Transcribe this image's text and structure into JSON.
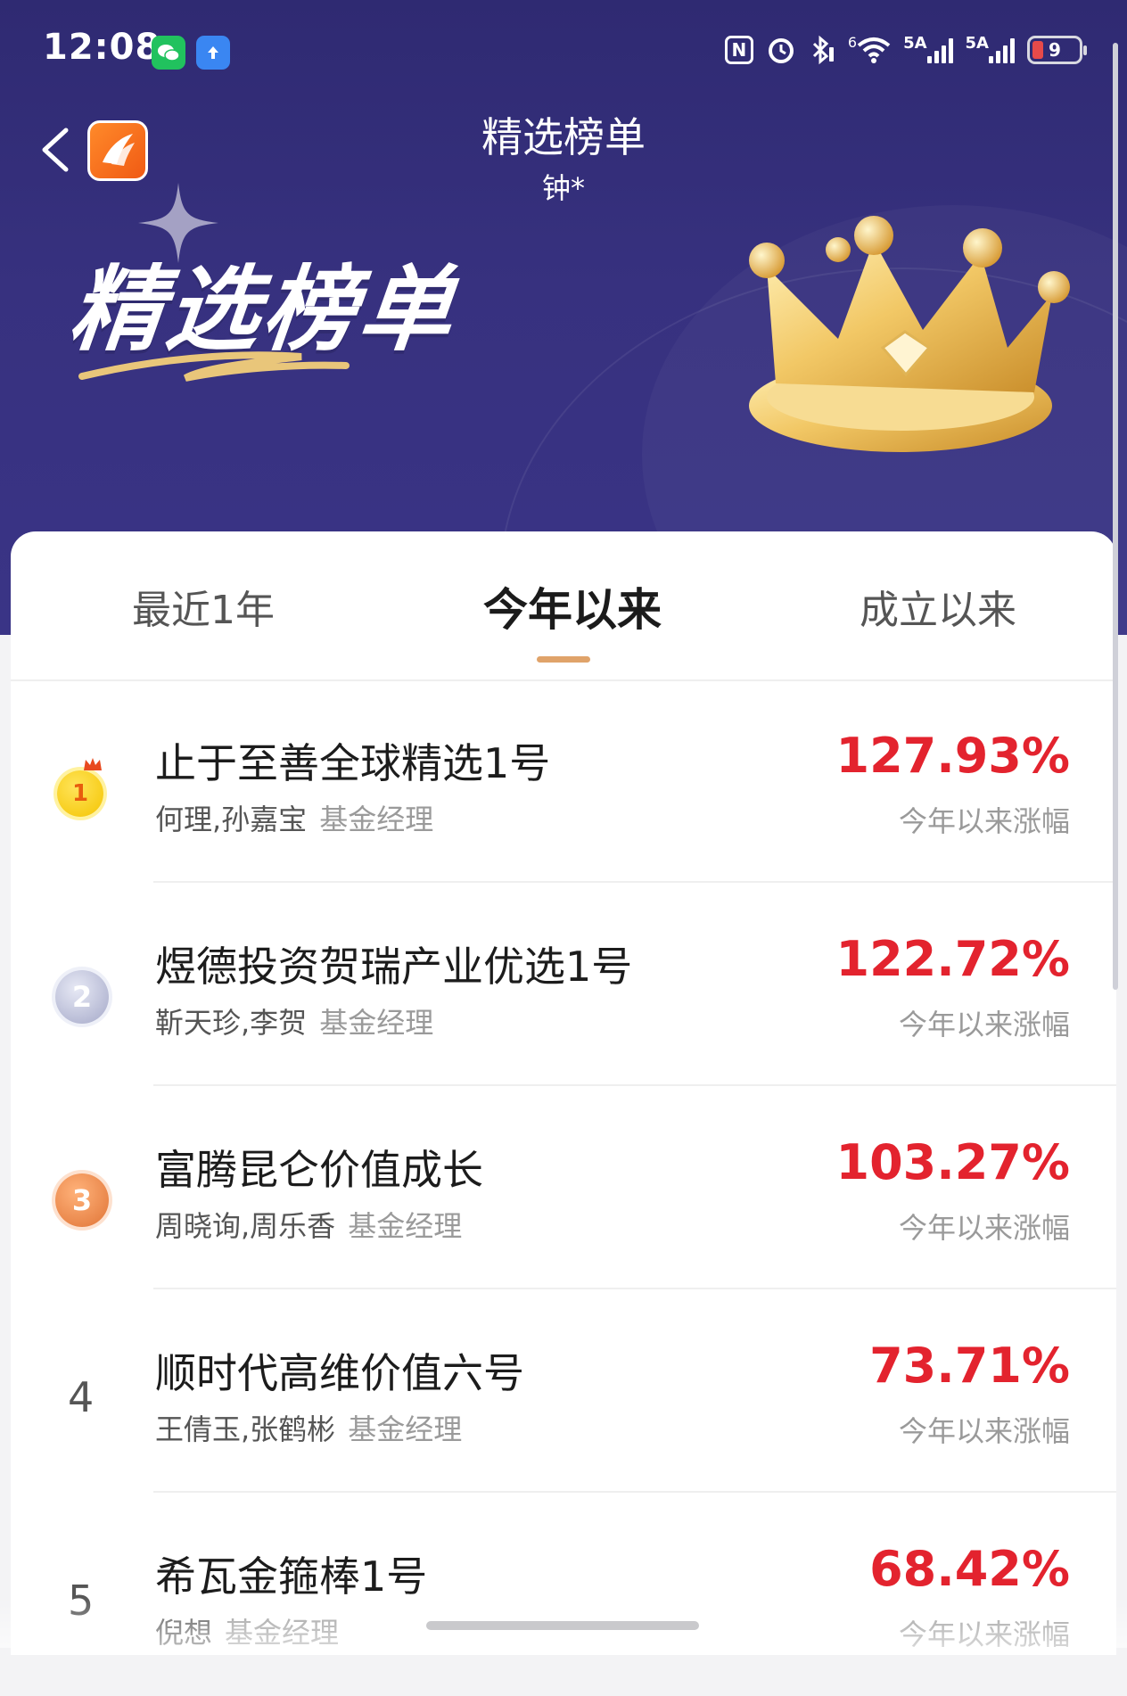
{
  "status_bar": {
    "time": "12:08",
    "net_label_1": "5A",
    "net_label_2": "5A",
    "wifi_label": "6",
    "battery": "9",
    "battery_level": 0.09,
    "icons": [
      "wechat-icon",
      "upload-icon",
      "nfc-icon",
      "alarm-icon",
      "bluetooth-icon",
      "wifi-icon",
      "signal-icon",
      "signal-icon",
      "battery-icon"
    ]
  },
  "nav": {
    "title": "精选榜单",
    "subtitle": "钟*"
  },
  "hero": {
    "banner_title": "精选榜单"
  },
  "tabs": [
    {
      "label": "最近1年",
      "active": false
    },
    {
      "label": "今年以来",
      "active": true
    },
    {
      "label": "成立以来",
      "active": false
    }
  ],
  "colors": {
    "hero_bg": "#37317f",
    "accent": "#e0a36a",
    "return_red": "#e3232e"
  },
  "funds": [
    {
      "rank": "1",
      "name": "止于至善全球精选1号",
      "managers": "何理,孙嘉宝",
      "role": "基金经理",
      "return": "127.93%",
      "return_label": "今年以来涨幅"
    },
    {
      "rank": "2",
      "name": "煜德投资贺瑞产业优选1号",
      "managers": "靳天珍,李贺",
      "role": "基金经理",
      "return": "122.72%",
      "return_label": "今年以来涨幅"
    },
    {
      "rank": "3",
      "name": "富腾昆仑价值成长",
      "managers": "周晓询,周乐香",
      "role": "基金经理",
      "return": "103.27%",
      "return_label": "今年以来涨幅"
    },
    {
      "rank": "4",
      "name": "顺时代高维价值六号",
      "managers": "王倩玉,张鹤彬",
      "role": "基金经理",
      "return": "73.71%",
      "return_label": "今年以来涨幅"
    },
    {
      "rank": "5",
      "name": "希瓦金箍棒1号",
      "managers": "倪想",
      "role": "基金经理",
      "return": "68.42%",
      "return_label": "今年以来涨幅"
    }
  ]
}
